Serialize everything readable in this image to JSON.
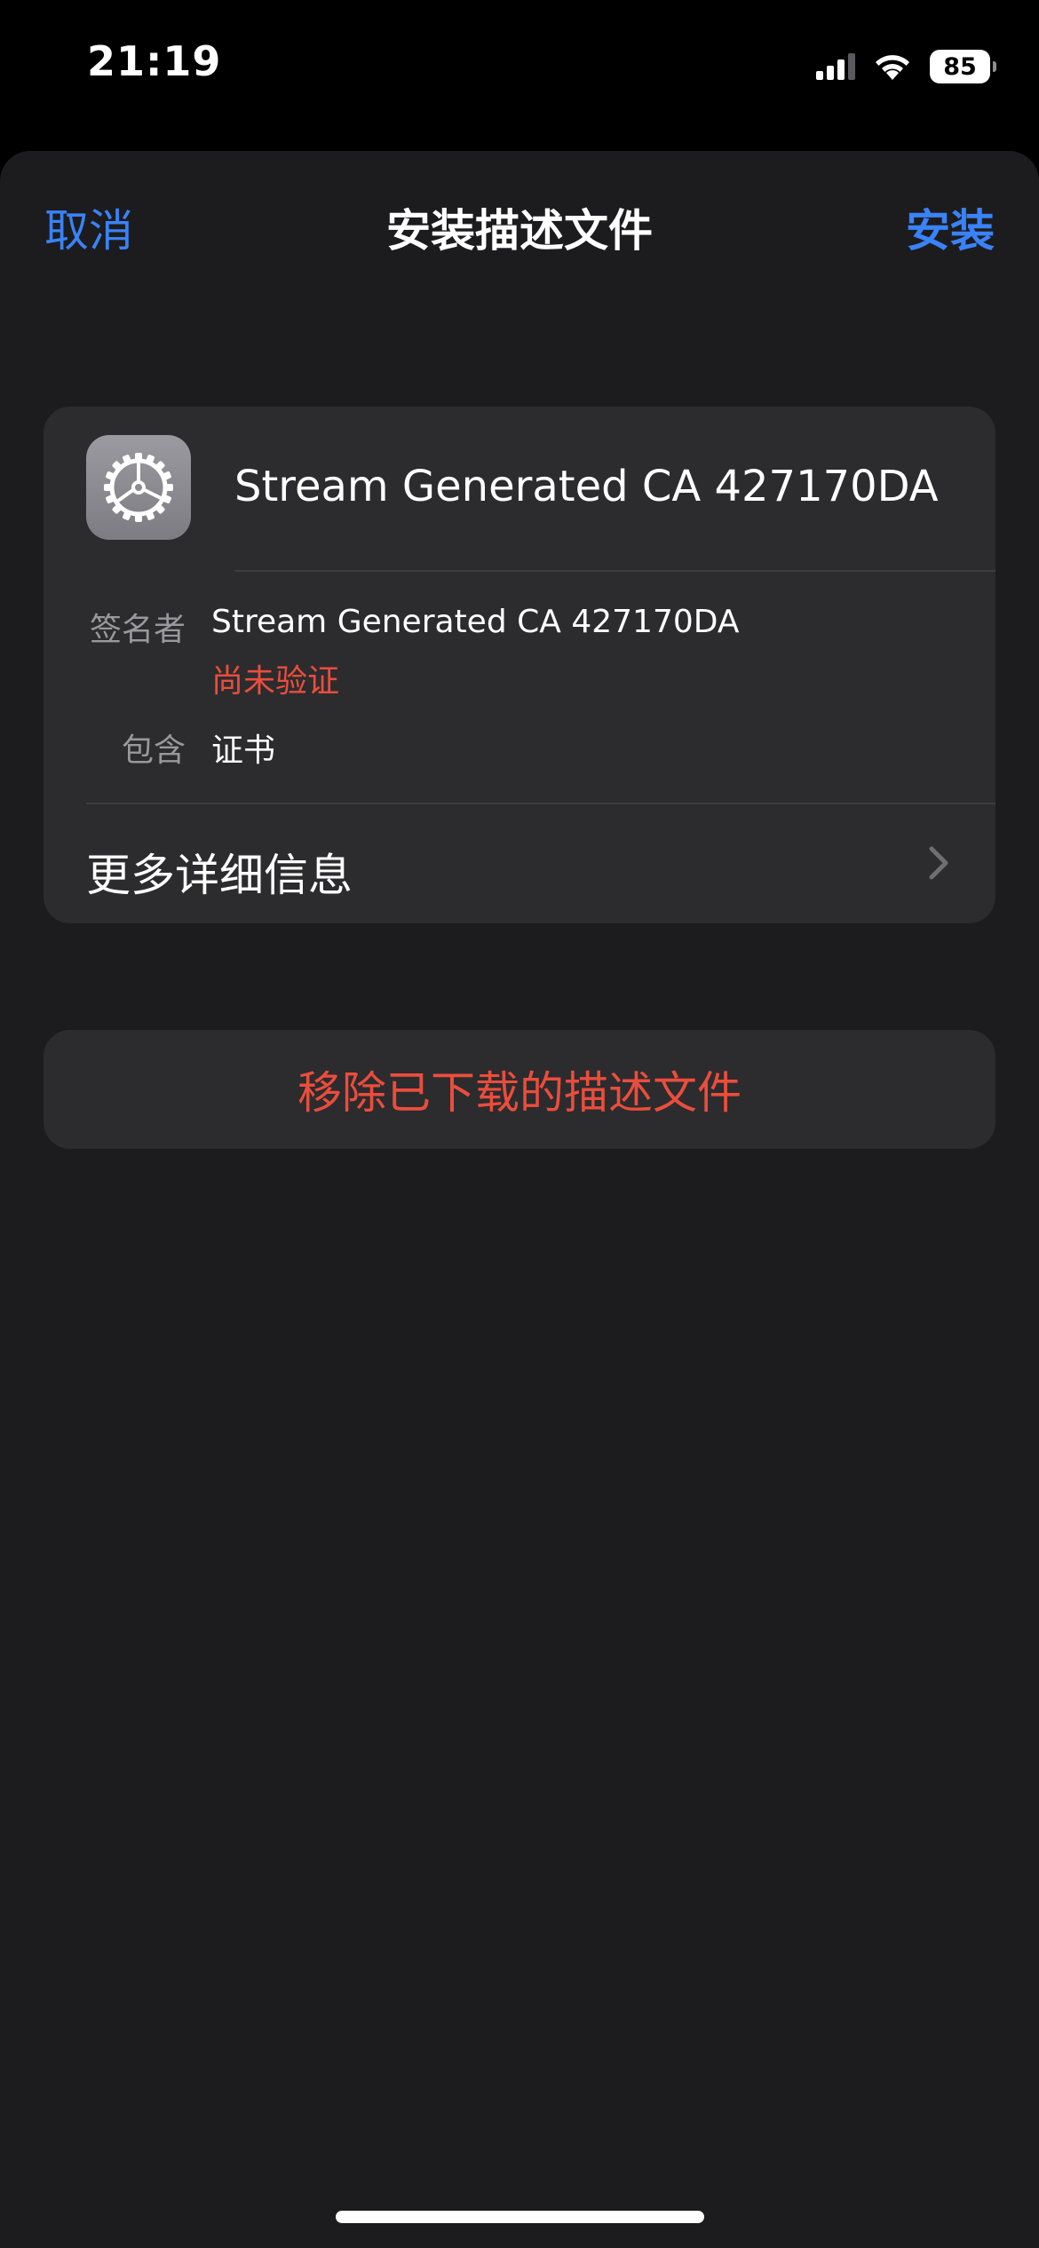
{
  "status_bar": {
    "time": "21:19",
    "battery": "85",
    "signal_icon": "cellular-signal-icon",
    "wifi_icon": "wifi-icon"
  },
  "nav": {
    "cancel_label": "取消",
    "title": "安装描述文件",
    "install_label": "安装"
  },
  "profile": {
    "icon": "settings-gear-icon",
    "name": "Stream Generated CA 427170DA",
    "signed_by_label": "签名者",
    "signed_by_value": "Stream Generated CA 427170DA",
    "verification_status": "尚未验证",
    "contains_label": "包含",
    "contains_value": "证书",
    "more_details_label": "更多详细信息"
  },
  "remove_button_label": "移除已下载的描述文件",
  "colors": {
    "accent": "#3a82f7",
    "danger": "#eb4d3d",
    "sheet_background": "#1c1c1e",
    "card_background": "#2c2c2e"
  }
}
